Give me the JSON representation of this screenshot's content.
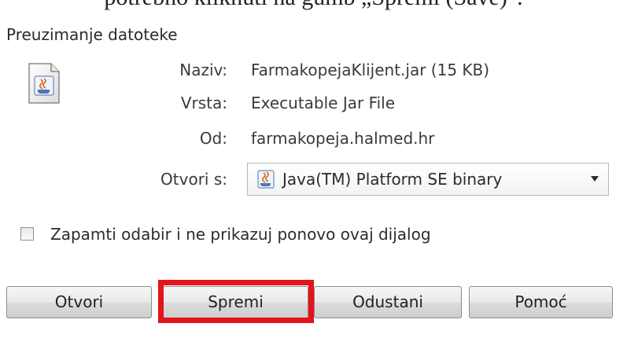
{
  "caption": {
    "text": "potrebno kliknuti na gumb „Spremi (Save)\"."
  },
  "dialog": {
    "title": "Preuzimanje datoteke",
    "file_icon": "java-jar-file-icon",
    "rows": [
      {
        "label": "Naziv:",
        "value": "FarmakopejaKlijent.jar (15 KB)"
      },
      {
        "label": "Vrsta:",
        "value": "Executable Jar File"
      },
      {
        "label": "Od:",
        "value": "farmakopeja.halmed.hr"
      }
    ],
    "open_with": {
      "label": "Otvori s:",
      "selected": "Java(TM) Platform SE binary",
      "icon": "java-icon"
    },
    "remember": {
      "label": "Zapamti odabir i ne prikazuj ponovo ovaj dijalog",
      "checked": false
    },
    "buttons": {
      "open": "Otvori",
      "save": "Spremi",
      "cancel": "Odustani",
      "help": "Pomoć"
    },
    "highlight_color": "#e4141b"
  }
}
